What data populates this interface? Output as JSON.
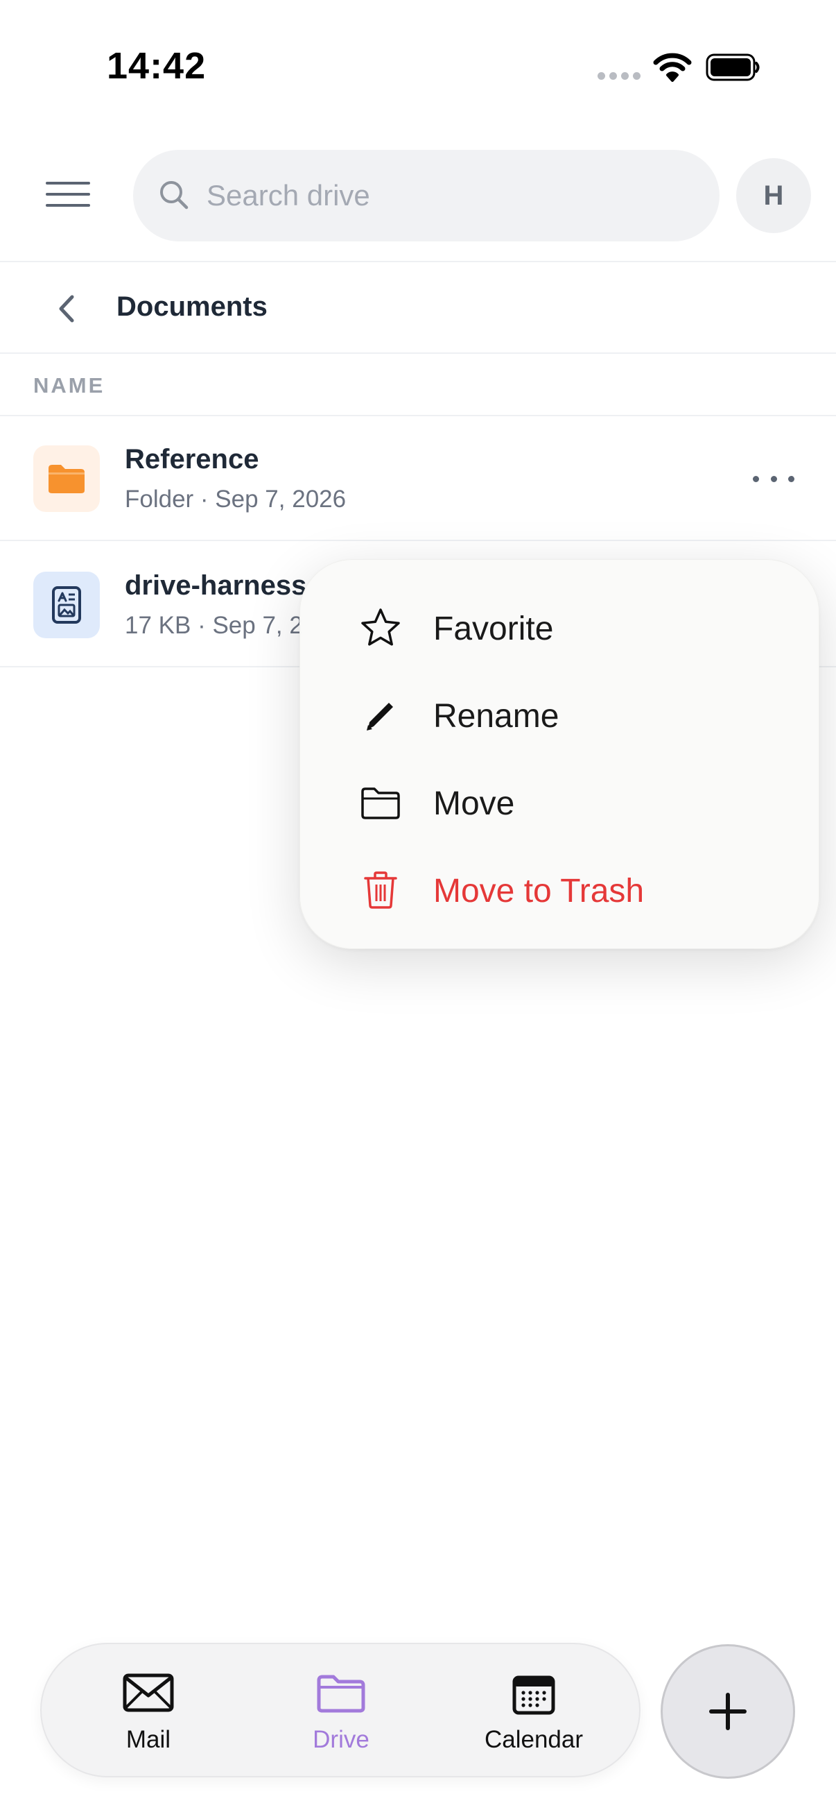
{
  "status_bar": {
    "time": "14:42"
  },
  "header": {
    "search_placeholder": "Search drive",
    "avatar_initial": "H"
  },
  "breadcrumb": {
    "title": "Documents"
  },
  "list": {
    "column_header": "NAME",
    "items": [
      {
        "name": "Reference",
        "meta": "Folder · Sep 7, 2026",
        "icon": "folder-icon"
      },
      {
        "name": "drive-harness",
        "meta": "17 KB · Sep 7, 2",
        "icon": "document-icon"
      }
    ]
  },
  "context_menu": {
    "items": [
      {
        "label": "Favorite",
        "icon": "star-icon"
      },
      {
        "label": "Rename",
        "icon": "pencil-icon"
      },
      {
        "label": "Move",
        "icon": "folder-outline-icon"
      },
      {
        "label": "Move to Trash",
        "icon": "trash-icon",
        "color": "#e53838"
      }
    ]
  },
  "tab_bar": {
    "tabs": [
      {
        "label": "Mail",
        "icon": "envelope-icon"
      },
      {
        "label": "Drive",
        "icon": "folder-icon",
        "active": true,
        "color": "#a27adb"
      },
      {
        "label": "Calendar",
        "icon": "calendar-icon"
      }
    ],
    "fab_icon": "plus-icon"
  },
  "colors": {
    "accent": "#a27adb",
    "danger": "#e53838",
    "folder_orange": "#f7922e",
    "doc_navy": "#23395d"
  }
}
